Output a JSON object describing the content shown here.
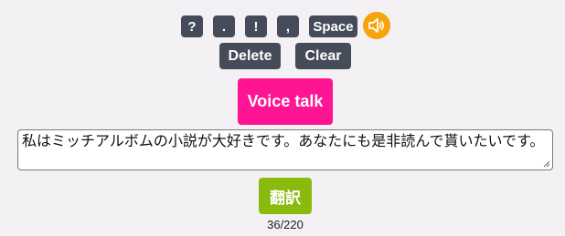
{
  "keys": {
    "question": "?",
    "period": ".",
    "exclamation": "!",
    "comma": ",",
    "space": "Space",
    "delete": "Delete",
    "clear": "Clear"
  },
  "speaker": {
    "icon": "speaker-icon",
    "color": "#f7a30c"
  },
  "voice_talk": {
    "label": "Voice talk",
    "color": "#ff1493"
  },
  "input": {
    "value": "私はミッチアルボムの小説が大好きです。あなたにも是非読んで貰いたいです。"
  },
  "translate": {
    "label": "翻訳",
    "color": "#8bba0f"
  },
  "counter": "36/220",
  "colors": {
    "key_bg": "#454b59",
    "page_bg": "#f3f1f3"
  }
}
